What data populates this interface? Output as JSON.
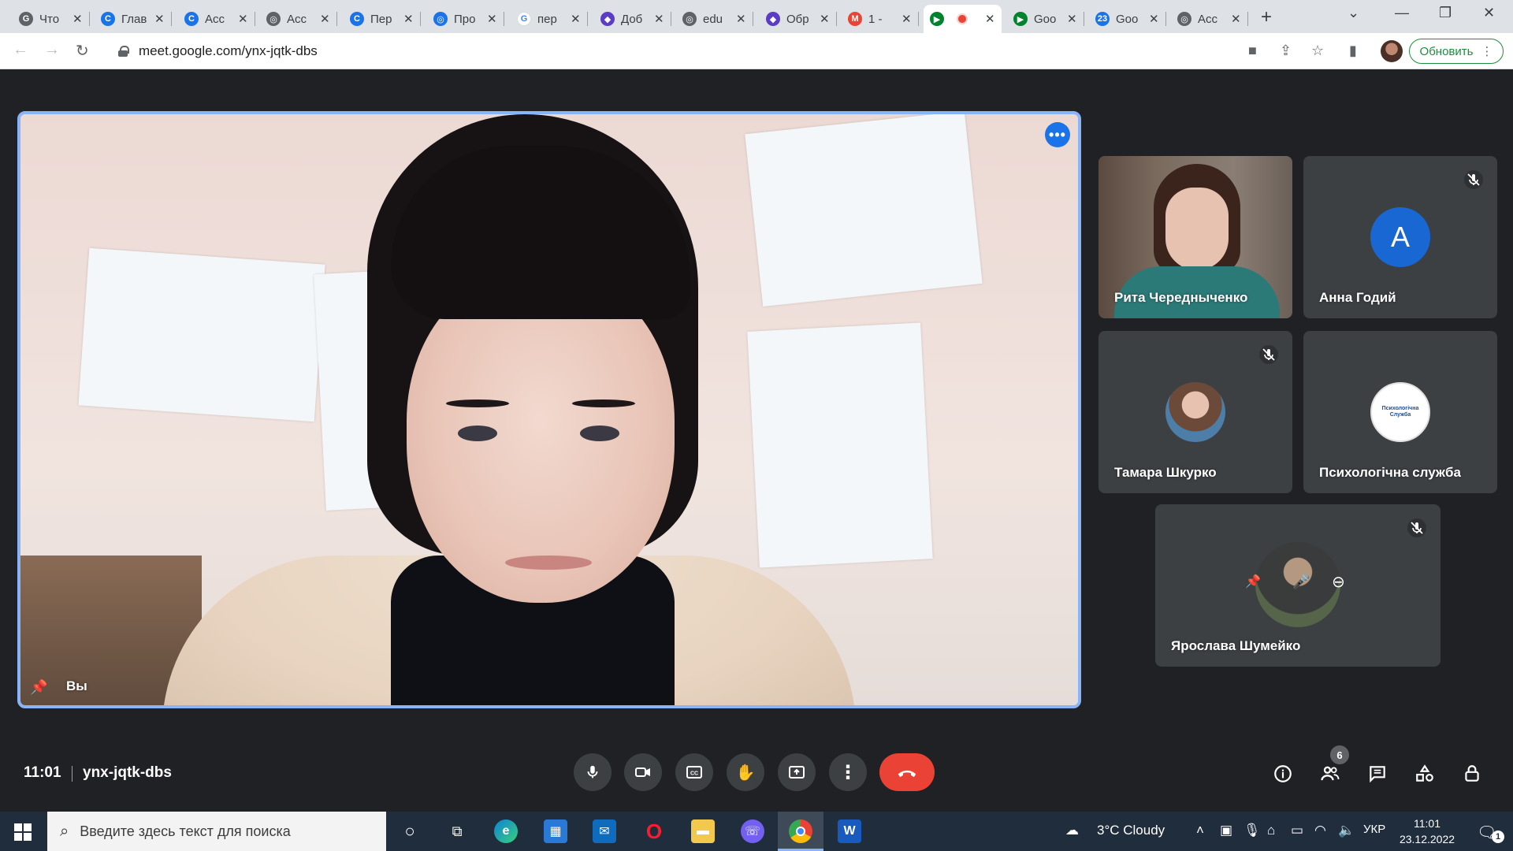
{
  "browser": {
    "tabs": [
      {
        "title": "Что",
        "color": "#5f6368",
        "glyph": "G"
      },
      {
        "title": "Глав",
        "color": "#1a73e8",
        "glyph": "C"
      },
      {
        "title": "Асс",
        "color": "#1a73e8",
        "glyph": "C"
      },
      {
        "title": "Асс",
        "color": "#5f6368",
        "glyph": "◎"
      },
      {
        "title": "Пер",
        "color": "#1a73e8",
        "glyph": "C"
      },
      {
        "title": "Про",
        "color": "#1a73e8",
        "glyph": "◎"
      },
      {
        "title": "пер",
        "color": "#ffffff",
        "glyph": "G"
      },
      {
        "title": "Доб",
        "color": "#5b3cc4",
        "glyph": "◆"
      },
      {
        "title": "edu",
        "color": "#5f6368",
        "glyph": "◎"
      },
      {
        "title": "Обр",
        "color": "#5b3cc4",
        "glyph": "◆"
      },
      {
        "title": "1 -",
        "color": "#ea4335",
        "glyph": "M"
      },
      {
        "title": "",
        "color": "#00832d",
        "glyph": "▶",
        "active": true
      },
      {
        "title": "Goo",
        "color": "#00832d",
        "glyph": "▶"
      },
      {
        "title": "Goo",
        "color": "#1a73e8",
        "glyph": "23"
      },
      {
        "title": "Асс",
        "color": "#5f6368",
        "glyph": "◎"
      }
    ],
    "url": "meet.google.com/ynx-jqtk-dbs",
    "update_button": "Обновить"
  },
  "meet": {
    "main_tile": {
      "name": "Вы"
    },
    "participants": [
      {
        "name": "Рита Чередныченко",
        "kind": "video",
        "muted": false
      },
      {
        "name": "Анна Годий",
        "kind": "letter",
        "letter": "A",
        "avatar_color": "#1967d2",
        "muted": true
      },
      {
        "name": "Тамара Шкурко",
        "kind": "photo",
        "muted": true
      },
      {
        "name": "Психологічна служба",
        "kind": "logo",
        "logo_text": "Психологічна Служба",
        "muted": false
      },
      {
        "name": "Ярослава Шумейко",
        "kind": "photo-hover",
        "muted": true
      }
    ],
    "time": "11:01",
    "meeting_code": "ynx-jqtk-dbs",
    "people_count": "6",
    "end_call_color": "#ea4335",
    "accent_color": "#8ab4f8"
  },
  "taskbar": {
    "search_placeholder": "Введите здесь текст для поиска",
    "weather": "3°C  Cloudy",
    "language": "УКР",
    "time": "11:01",
    "date": "23.12.2022",
    "notification_count": "1"
  }
}
